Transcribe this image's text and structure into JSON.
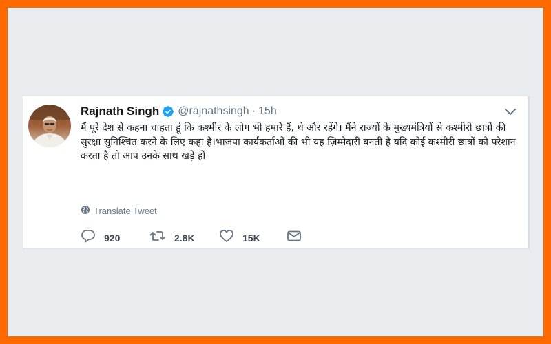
{
  "tweet": {
    "display_name": "Rajnath Singh",
    "handle": "@rajnathsingh",
    "separator": "·",
    "time": "15h",
    "text": "मैं पूरे देश से कहना चाहता हूं कि कश्मीर के लोग भी हमारे हैं, थे और रहेंगे। मैंने राज्यों के मुख्यमंत्रियों से कश्मीरी छात्रों की सुरक्षा सुनिश्चित करने के लिए कहा है।भाजपा कार्यकर्ताओं की भी यह ज़िम्मेदारी बनती है यदि कोई कश्मीरी छात्रों को परेशान करता है तो आप उनके साथ खड़े हों",
    "translate_label": "Translate Tweet",
    "replies": "920",
    "retweets": "2.8K",
    "likes": "15K"
  },
  "icons": {
    "verified": "verified-badge-icon",
    "caret": "chevron-down-icon",
    "translate": "globe-icon",
    "reply": "reply-icon",
    "retweet": "retweet-icon",
    "like": "heart-icon",
    "message": "direct-message-icon"
  },
  "colors": {
    "frame_border": "#ff6a00",
    "background": "#e9ecef",
    "card": "#ffffff",
    "verified_blue": "#1da1f2",
    "secondary_text": "#657786",
    "primary_text": "#14171a"
  }
}
